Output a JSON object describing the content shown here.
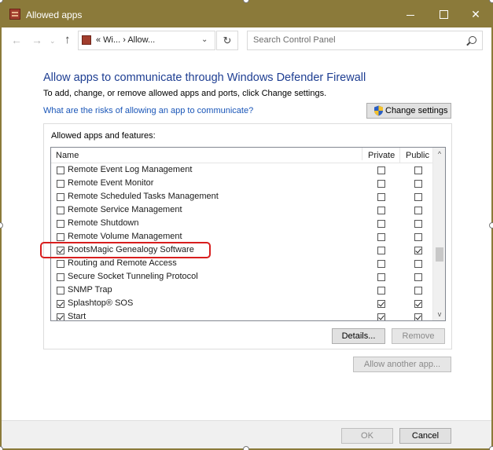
{
  "window": {
    "title": "Allowed apps",
    "controls": {
      "minimize": "",
      "maximize": "",
      "close": "✕"
    }
  },
  "nav": {
    "back": "←",
    "forward": "→",
    "dropdown": "⌄",
    "up": "↑",
    "address": "«  Wi...  ›  Allow...",
    "address_chevron": "⌄",
    "refresh": "↻",
    "search_placeholder": "Search Control Panel"
  },
  "content": {
    "heading": "Allow apps to communicate through Windows Defender Firewall",
    "subtext": "To add, change, or remove allowed apps and ports, click Change settings.",
    "risk_link": "What are the risks of allowing an app to communicate?",
    "change_settings": "Change settings",
    "group_label": "Allowed apps and features:",
    "columns": {
      "name": "Name",
      "private": "Private",
      "public": "Public"
    },
    "rows": [
      {
        "name": "Remote Event Log Management",
        "checked": false,
        "private": false,
        "public": false
      },
      {
        "name": "Remote Event Monitor",
        "checked": false,
        "private": false,
        "public": false
      },
      {
        "name": "Remote Scheduled Tasks Management",
        "checked": false,
        "private": false,
        "public": false
      },
      {
        "name": "Remote Service Management",
        "checked": false,
        "private": false,
        "public": false
      },
      {
        "name": "Remote Shutdown",
        "checked": false,
        "private": false,
        "public": false
      },
      {
        "name": "Remote Volume Management",
        "checked": false,
        "private": false,
        "public": false
      },
      {
        "name": "RootsMagic Genealogy Software",
        "checked": true,
        "private": false,
        "public": true
      },
      {
        "name": "Routing and Remote Access",
        "checked": false,
        "private": false,
        "public": false
      },
      {
        "name": "Secure Socket Tunneling Protocol",
        "checked": false,
        "private": false,
        "public": false
      },
      {
        "name": "SNMP Trap",
        "checked": false,
        "private": false,
        "public": false
      },
      {
        "name": "Splashtop® SOS",
        "checked": true,
        "private": true,
        "public": true
      },
      {
        "name": "Start",
        "checked": true,
        "private": true,
        "public": true
      }
    ],
    "scroll": {
      "up": "^",
      "down": "v"
    },
    "details": "Details...",
    "remove": "Remove",
    "allow_another": "Allow another app..."
  },
  "footer": {
    "ok": "OK",
    "cancel": "Cancel"
  },
  "colors": {
    "titlebar": "#8b7a3a",
    "heading": "#1e3e92",
    "link": "#1a56b8",
    "highlight": "#d81e1e"
  }
}
